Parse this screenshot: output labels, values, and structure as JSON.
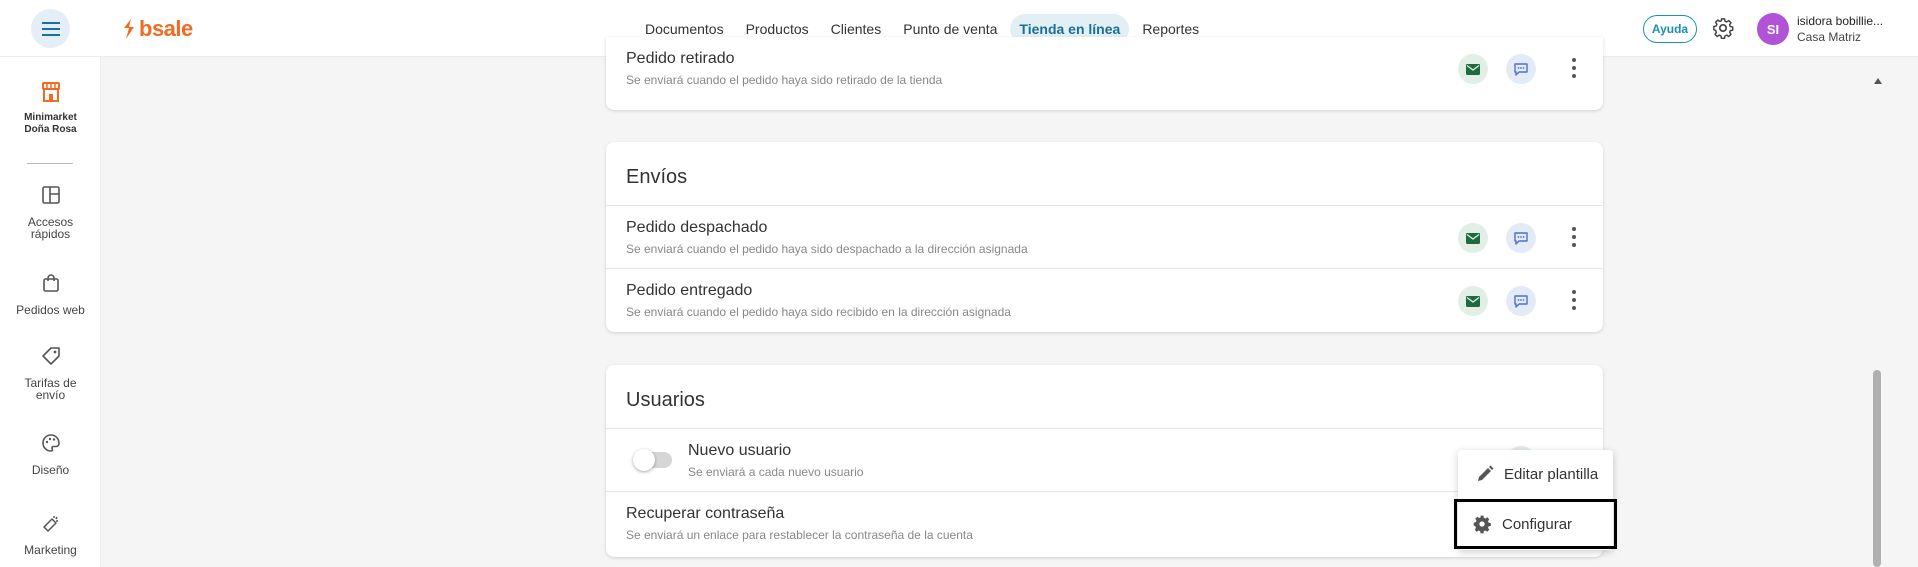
{
  "header": {
    "logo_text": "bsale",
    "nav": [
      "Documentos",
      "Productos",
      "Clientes",
      "Punto de venta",
      "Tienda en línea",
      "Reportes"
    ],
    "active_nav": "Tienda en línea",
    "help_label": "Ayuda",
    "user": {
      "initials": "SI",
      "name": "isidora bobillie...",
      "branch": "Casa Matriz"
    }
  },
  "sidebar": {
    "store_name_1": "Minimarket",
    "store_name_2": "Doña Rosa",
    "items": [
      {
        "label_1": "Accesos",
        "label_2": "rápidos",
        "icon": "layout-icon"
      },
      {
        "label_1": "Pedidos web",
        "label_2": "",
        "icon": "shopping-bag-icon"
      },
      {
        "label_1": "Tarifas de",
        "label_2": "envío",
        "icon": "tag-icon"
      },
      {
        "label_1": "Diseño",
        "label_2": "",
        "icon": "palette-icon"
      },
      {
        "label_1": "Marketing",
        "label_2": "",
        "icon": "megaphone-icon"
      }
    ]
  },
  "sections": {
    "partial": {
      "row": {
        "title": "Pedido retirado",
        "desc": "Se enviará cuando el pedido haya sido retirado de la tienda"
      }
    },
    "envios": {
      "title": "Envíos",
      "rows": [
        {
          "title": "Pedido despachado",
          "desc": "Se enviará cuando el pedido haya sido despachado a la dirección asignada"
        },
        {
          "title": "Pedido entregado",
          "desc": "Se enviará cuando el pedido haya sido recibido en la dirección asignada"
        }
      ]
    },
    "usuarios": {
      "title": "Usuarios",
      "rows": [
        {
          "title": "Nuevo usuario",
          "desc": "Se enviará a cada nuevo usuario",
          "toggle_on": false
        },
        {
          "title": "Recuperar contraseña",
          "desc": "Se enviará un enlace para restablecer la contraseña de la cuenta"
        }
      ]
    }
  },
  "context_menu": {
    "edit_label": "Editar plantilla",
    "configure_label": "Configurar"
  },
  "colors": {
    "brand": "#f26b22",
    "accent": "#1a8fb8",
    "mail_green": "#1e6b3f",
    "chat_blue": "#4a6fd0",
    "avatar": "#b053d6"
  }
}
